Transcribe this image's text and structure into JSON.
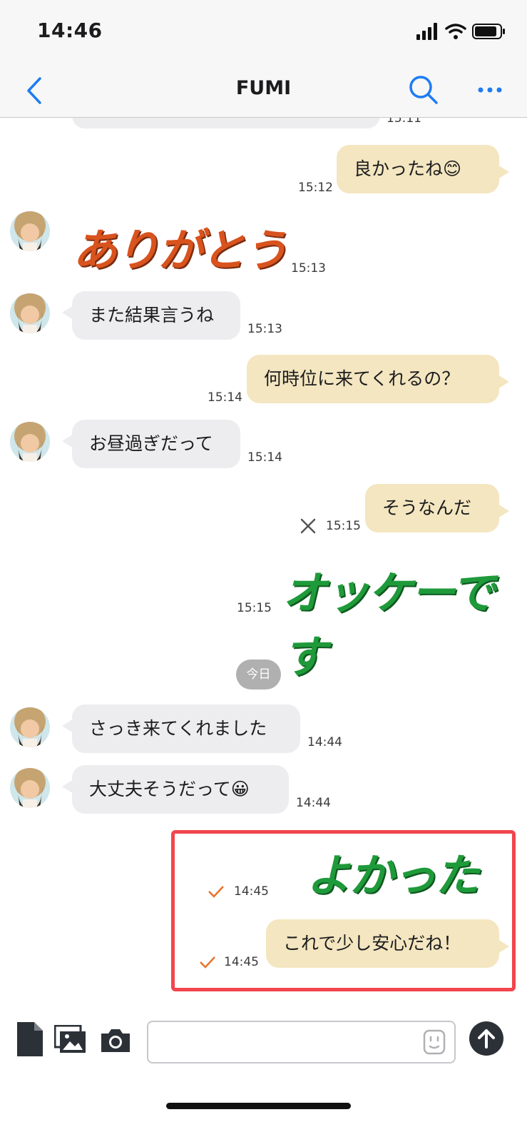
{
  "status": {
    "time": "14:46"
  },
  "nav": {
    "title": "FUMI"
  },
  "messages": {
    "m0": {
      "time": "15:11"
    },
    "m1": {
      "text": "良かったね😊",
      "time": "15:12"
    },
    "m2": {
      "sticker": "ありがとう",
      "time": "15:13"
    },
    "m3": {
      "text": "また結果言うね",
      "time": "15:13"
    },
    "m4": {
      "text": "何時位に来てくれるの？",
      "time": "15:14"
    },
    "m5": {
      "text": "お昼過ぎだって",
      "time": "15:14"
    },
    "m6": {
      "text": "そうなんだ",
      "time": "15:15"
    },
    "m7": {
      "sticker": "オッケーです",
      "time": "15:15"
    },
    "date_divider": "今日",
    "m8": {
      "text": "さっき来てくれました",
      "time": "14:44"
    },
    "m9": {
      "text": "大丈夫そうだって😀",
      "time": "14:44"
    },
    "m10": {
      "sticker": "よかった",
      "time": "14:45"
    },
    "m11": {
      "text": "これで少し安心だね！",
      "time": "14:45"
    }
  },
  "input": {
    "placeholder": ""
  },
  "colors": {
    "incoming_bubble": "#ededf0",
    "outgoing_bubble": "#f3e6c0",
    "accent": "#1e7cf2",
    "highlight": "#f2454d",
    "check": "#e8722a"
  }
}
